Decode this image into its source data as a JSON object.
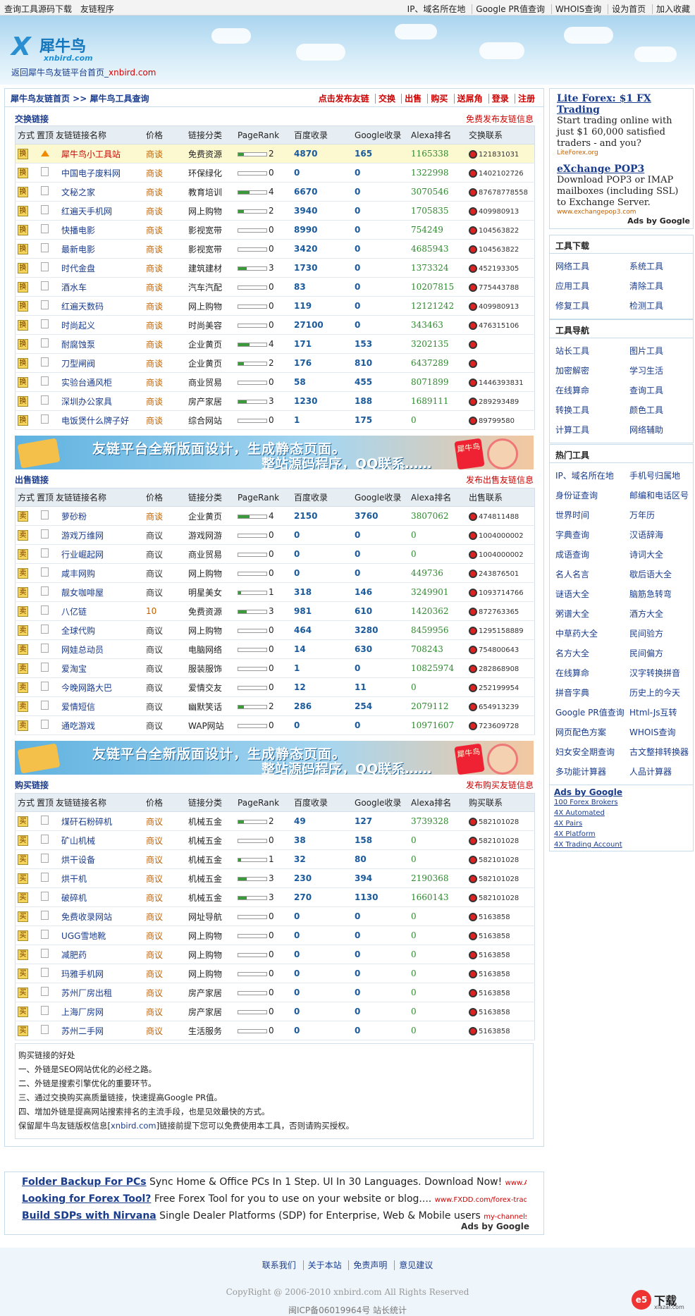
{
  "topbar": {
    "left": [
      "查询工具源码下载",
      "友链程序"
    ],
    "right": [
      "IP、域名所在地",
      "Google PR值查询",
      "WHOIS查询",
      "设为首页",
      "加入收藏"
    ]
  },
  "logo": {
    "name": "犀牛鸟",
    "url": "xnbird.com"
  },
  "backlink": {
    "text": "返回犀牛鸟友链平台首页_",
    "url": "xnbird.com"
  },
  "crumb": {
    "left": "犀牛鸟友链首页 >> 犀牛鸟工具查询",
    "right": [
      "点击发布友链",
      "交换",
      "出售",
      "购买",
      "送屌角",
      "登录",
      "注册"
    ]
  },
  "headers": [
    "方式",
    "置顶",
    "友链链接名称",
    "价格",
    "链接分类",
    "PageRank",
    "百度收录",
    "Google收录",
    "Alexa排名"
  ],
  "exchange": {
    "title": "交换链接",
    "right": "免费发布友链信息",
    "contact": "交换联系",
    "rows": [
      {
        "mode": "换",
        "top": true,
        "name": "犀牛鸟小工具站",
        "price": "商谈",
        "cat": "免费资源",
        "pr": 2,
        "bd": "4870",
        "gg": "165",
        "ax": "1165338",
        "qq": "121831031"
      },
      {
        "mode": "换",
        "name": "中国电子废料网",
        "price": "商谈",
        "cat": "环保绿化",
        "pr": 0,
        "bd": "0",
        "gg": "0",
        "ax": "1322998",
        "qq": "1402102726"
      },
      {
        "mode": "换",
        "name": "文秘之家",
        "price": "商谈",
        "cat": "教育培训",
        "pr": 4,
        "bd": "6670",
        "gg": "0",
        "ax": "3070546",
        "qq": "87678778558"
      },
      {
        "mode": "换",
        "name": "红遍天手机网",
        "price": "商谈",
        "cat": "网上购物",
        "pr": 2,
        "bd": "3940",
        "gg": "0",
        "ax": "1705835",
        "qq": "409980913"
      },
      {
        "mode": "换",
        "name": "快播电影",
        "price": "商谈",
        "cat": "影视宽带",
        "pr": 0,
        "bd": "8990",
        "gg": "0",
        "ax": "754249",
        "qq": "104563822"
      },
      {
        "mode": "换",
        "name": "最新电影",
        "price": "商谈",
        "cat": "影视宽带",
        "pr": 0,
        "bd": "3420",
        "gg": "0",
        "ax": "4685943",
        "qq": "104563822"
      },
      {
        "mode": "换",
        "name": "时代金盘",
        "price": "商谈",
        "cat": "建筑建材",
        "pr": 3,
        "bd": "1730",
        "gg": "0",
        "ax": "1373324",
        "qq": "452193305"
      },
      {
        "mode": "换",
        "name": "酒水车",
        "price": "商谈",
        "cat": "汽车汽配",
        "pr": 0,
        "bd": "83",
        "gg": "0",
        "ax": "10207815",
        "qq": "775443788"
      },
      {
        "mode": "换",
        "name": "红遍天数码",
        "price": "商谈",
        "cat": "网上购物",
        "pr": 0,
        "bd": "119",
        "gg": "0",
        "ax": "12121242",
        "qq": "409980913"
      },
      {
        "mode": "换",
        "name": "时尚起义",
        "price": "商谈",
        "cat": "时尚美容",
        "pr": 0,
        "bd": "27100",
        "gg": "0",
        "ax": "343463",
        "qq": "476315106"
      },
      {
        "mode": "换",
        "name": "耐腐蚀泵",
        "price": "商谈",
        "cat": "企业黄页",
        "pr": 4,
        "bd": "171",
        "gg": "153",
        "ax": "3202135",
        "qq": ""
      },
      {
        "mode": "换",
        "name": "刀型闸阀",
        "price": "商谈",
        "cat": "企业黄页",
        "pr": 2,
        "bd": "176",
        "gg": "810",
        "ax": "6437289",
        "qq": ""
      },
      {
        "mode": "换",
        "name": "实验台通风柜",
        "price": "商谈",
        "cat": "商业贸易",
        "pr": 0,
        "bd": "58",
        "gg": "455",
        "ax": "8071899",
        "qq": "1446393831"
      },
      {
        "mode": "换",
        "name": "深圳办公家具",
        "price": "商谈",
        "cat": "房产家居",
        "pr": 3,
        "bd": "1230",
        "gg": "188",
        "ax": "1689111",
        "qq": "289293489"
      },
      {
        "mode": "换",
        "name": "电饭煲什么牌子好",
        "price": "商谈",
        "cat": "综合网站",
        "pr": 0,
        "bd": "1",
        "gg": "175",
        "ax": "0",
        "qq": "89799580"
      }
    ]
  },
  "banner": {
    "line1": "友链平台全新版面设计，生成静态页面。",
    "line2": "整站源码程序，QQ联系……",
    "tag": "犀牛鸟"
  },
  "sell": {
    "title": "出售链接",
    "right": "发布出售友链信息",
    "contact": "出售联系",
    "rows": [
      {
        "mode": "卖",
        "name": "萝砂粉",
        "price": "商谈",
        "cat": "企业黄页",
        "pr": 4,
        "bd": "2150",
        "gg": "3760",
        "ax": "3807062",
        "qq": "474811488"
      },
      {
        "mode": "卖",
        "name": "游戏万维网",
        "price": "商议",
        "cat": "游戏网游",
        "pr": 0,
        "bd": "0",
        "gg": "0",
        "ax": "0",
        "qq": "1004000002",
        "gray": true
      },
      {
        "mode": "卖",
        "name": "行业崛起网",
        "price": "商议",
        "cat": "商业贸易",
        "pr": 0,
        "bd": "0",
        "gg": "0",
        "ax": "0",
        "qq": "1004000002",
        "gray": true
      },
      {
        "mode": "卖",
        "name": "咸丰网购",
        "price": "商议",
        "cat": "网上购物",
        "pr": 0,
        "bd": "0",
        "gg": "0",
        "ax": "449736",
        "qq": "243876501",
        "gray": true
      },
      {
        "mode": "卖",
        "name": "靓女咖啡屋",
        "price": "商议",
        "cat": "明星美女",
        "pr": 1,
        "bd": "318",
        "gg": "146",
        "ax": "3249901",
        "qq": "1093714766",
        "gray": true
      },
      {
        "mode": "卖",
        "name": "八亿链",
        "price": "10",
        "cat": "免费资源",
        "pr": 3,
        "bd": "981",
        "gg": "610",
        "ax": "1420362",
        "qq": "872763365"
      },
      {
        "mode": "卖",
        "name": "全球代购",
        "price": "商议",
        "cat": "网上购物",
        "pr": 0,
        "bd": "464",
        "gg": "3280",
        "ax": "8459956",
        "qq": "1295158889",
        "gray": true
      },
      {
        "mode": "卖",
        "name": "网娃总动员",
        "price": "商议",
        "cat": "电脑网络",
        "pr": 0,
        "bd": "14",
        "gg": "630",
        "ax": "708243",
        "qq": "754800643",
        "gray": true
      },
      {
        "mode": "卖",
        "name": "爱淘宝",
        "price": "商议",
        "cat": "服装服饰",
        "pr": 0,
        "bd": "1",
        "gg": "0",
        "ax": "10825974",
        "qq": "282868908",
        "gray": true
      },
      {
        "mode": "卖",
        "name": "今晚网路大巴",
        "price": "商议",
        "cat": "爱情交友",
        "pr": 0,
        "bd": "12",
        "gg": "11",
        "ax": "0",
        "qq": "252199954",
        "gray": true
      },
      {
        "mode": "卖",
        "name": "爱情短信",
        "price": "商议",
        "cat": "幽默笑话",
        "pr": 2,
        "bd": "286",
        "gg": "254",
        "ax": "2079112",
        "qq": "654913239",
        "gray": true
      },
      {
        "mode": "卖",
        "name": "通吃游戏",
        "price": "商议",
        "cat": "WAP网站",
        "pr": 0,
        "bd": "0",
        "gg": "0",
        "ax": "10971607",
        "qq": "723609728",
        "gray": true
      }
    ]
  },
  "buy": {
    "title": "购买链接",
    "right": "发布购买友链信息",
    "contact": "购买联系",
    "rows": [
      {
        "mode": "买",
        "name": "煤矸石粉碎机",
        "price": "商议",
        "cat": "机械五金",
        "pr": 2,
        "bd": "49",
        "gg": "127",
        "ax": "3739328",
        "qq": "582101028"
      },
      {
        "mode": "买",
        "name": "矿山机械",
        "price": "商议",
        "cat": "机械五金",
        "pr": 0,
        "bd": "38",
        "gg": "158",
        "ax": "0",
        "qq": "582101028"
      },
      {
        "mode": "买",
        "name": "烘干设备",
        "price": "商议",
        "cat": "机械五金",
        "pr": 1,
        "bd": "32",
        "gg": "80",
        "ax": "0",
        "qq": "582101028"
      },
      {
        "mode": "买",
        "name": "烘干机",
        "price": "商议",
        "cat": "机械五金",
        "pr": 3,
        "bd": "230",
        "gg": "394",
        "ax": "2190368",
        "qq": "582101028"
      },
      {
        "mode": "买",
        "name": "破碎机",
        "price": "商议",
        "cat": "机械五金",
        "pr": 3,
        "bd": "270",
        "gg": "1130",
        "ax": "1660143",
        "qq": "582101028"
      },
      {
        "mode": "买",
        "name": "免费收录网站",
        "price": "商议",
        "cat": "网址导航",
        "pr": 0,
        "bd": "0",
        "gg": "0",
        "ax": "0",
        "qq": "5163858"
      },
      {
        "mode": "买",
        "name": "UGG雪地靴",
        "price": "商议",
        "cat": "网上购物",
        "pr": 0,
        "bd": "0",
        "gg": "0",
        "ax": "0",
        "qq": "5163858"
      },
      {
        "mode": "买",
        "name": "减肥药",
        "price": "商议",
        "cat": "网上购物",
        "pr": 0,
        "bd": "0",
        "gg": "0",
        "ax": "0",
        "qq": "5163858"
      },
      {
        "mode": "买",
        "name": "玛雅手机网",
        "price": "商议",
        "cat": "网上购物",
        "pr": 0,
        "bd": "0",
        "gg": "0",
        "ax": "0",
        "qq": "5163858"
      },
      {
        "mode": "买",
        "name": "苏州厂房出租",
        "price": "商议",
        "cat": "房产家居",
        "pr": 0,
        "bd": "0",
        "gg": "0",
        "ax": "0",
        "qq": "5163858"
      },
      {
        "mode": "买",
        "name": "上海厂房网",
        "price": "商议",
        "cat": "房产家居",
        "pr": 0,
        "bd": "0",
        "gg": "0",
        "ax": "0",
        "qq": "5163858"
      },
      {
        "mode": "买",
        "name": "苏州二手网",
        "price": "商议",
        "cat": "生活服务",
        "pr": 0,
        "bd": "0",
        "gg": "0",
        "ax": "0",
        "qq": "5163858"
      }
    ]
  },
  "info": {
    "title": "购买链接的好处",
    "lines": [
      "一、外链是SEO网站优化的必经之路。",
      "二、外链是搜索引擎优化的重要环节。",
      "三、通过交换购买高质量链接，快速提高Google PR值。",
      "四、增加外链是提高网站搜索排名的主流手段，也是见效最快的方式。"
    ],
    "last_a": "保留犀牛鸟友链版权信息[",
    "last_b": "xnbird.com",
    "last_c": "]链接前提下您可以免费使用本工具，否则请购买授权。"
  },
  "ads": [
    {
      "title": "Folder Backup For PCs",
      "text": " Sync Home & Office PCs In 1 Step. UI In 30 Languages. Download Now! ",
      "url": "www.AllwaySync"
    },
    {
      "title": "Looking for Forex Tool?",
      "text": " Free Forex Tool for you to use on your website or blog.... ",
      "url": "www.FXDD.com/forex-trading-tools"
    },
    {
      "title": "Build SDPs with Nirvana",
      "text": " Single Dealer Platforms (SDP) for Enterprise, Web & Mobile users ",
      "url": "my-channels.com/?SDP"
    }
  ],
  "ads_by": "Ads by Google",
  "side_ads": [
    {
      "title": "Lite Forex: $1 FX Trading",
      "desc": "Start trading online with just $1 60,000 satisfied traders - and you?",
      "url": "LiteForex.org"
    },
    {
      "title": "eXchange POP3",
      "desc": "Download POP3 or IMAP mailboxes (including SSL) to Exchange Server.",
      "url": "www.exchangepop3.com"
    }
  ],
  "tools_download": {
    "title": "工具下载",
    "items": [
      "网络工具",
      "系统工具",
      "应用工具",
      "清除工具",
      "修复工具",
      "检测工具"
    ]
  },
  "tools_nav": {
    "title": "工具导航",
    "items": [
      "站长工具",
      "图片工具",
      "加密解密",
      "学习生活",
      "在线算命",
      "查询工具",
      "转换工具",
      "颜色工具",
      "计算工具",
      "网络辅助"
    ]
  },
  "hot_tools": {
    "title": "热门工具",
    "items": [
      "IP、域名所在地",
      "手机号归属地",
      "身份证查询",
      "邮编和电话区号",
      "世界时间",
      "万年历",
      "字典查询",
      "汉语辞海",
      "成语查询",
      "诗词大全",
      "名人名言",
      "歇后语大全",
      "谜语大全",
      "脑筋急转弯",
      "粥谱大全",
      "酒方大全",
      "中草药大全",
      "民间验方",
      "名方大全",
      "民间偏方",
      "在线算命",
      "汉字转换拼音",
      "拼音字典",
      "历史上的今天",
      "Google PR值查询",
      "Html-Js互转",
      "网页配色方案",
      "WHOIS查询",
      "妇女安全期查询",
      "古文整排转换器",
      "多功能计算器",
      "人品计算器"
    ]
  },
  "gads": {
    "title": "Ads by Google",
    "links": [
      "100 Forex Brokers",
      "4X Automated",
      "4X Pairs",
      "4X Platform",
      "4X Trading Account"
    ]
  },
  "footer": {
    "links": [
      "联系我们",
      "关于本站",
      "免责声明",
      "意见建议"
    ],
    "copyright": "CopyRight @ 2006-2010 xnbird.com All Rights Reserved",
    "icp": "闽ICP备06019964号 站长统计",
    "wm_c": "e5",
    "wm_k": "下载",
    "wm_s": "xiazai.com"
  }
}
